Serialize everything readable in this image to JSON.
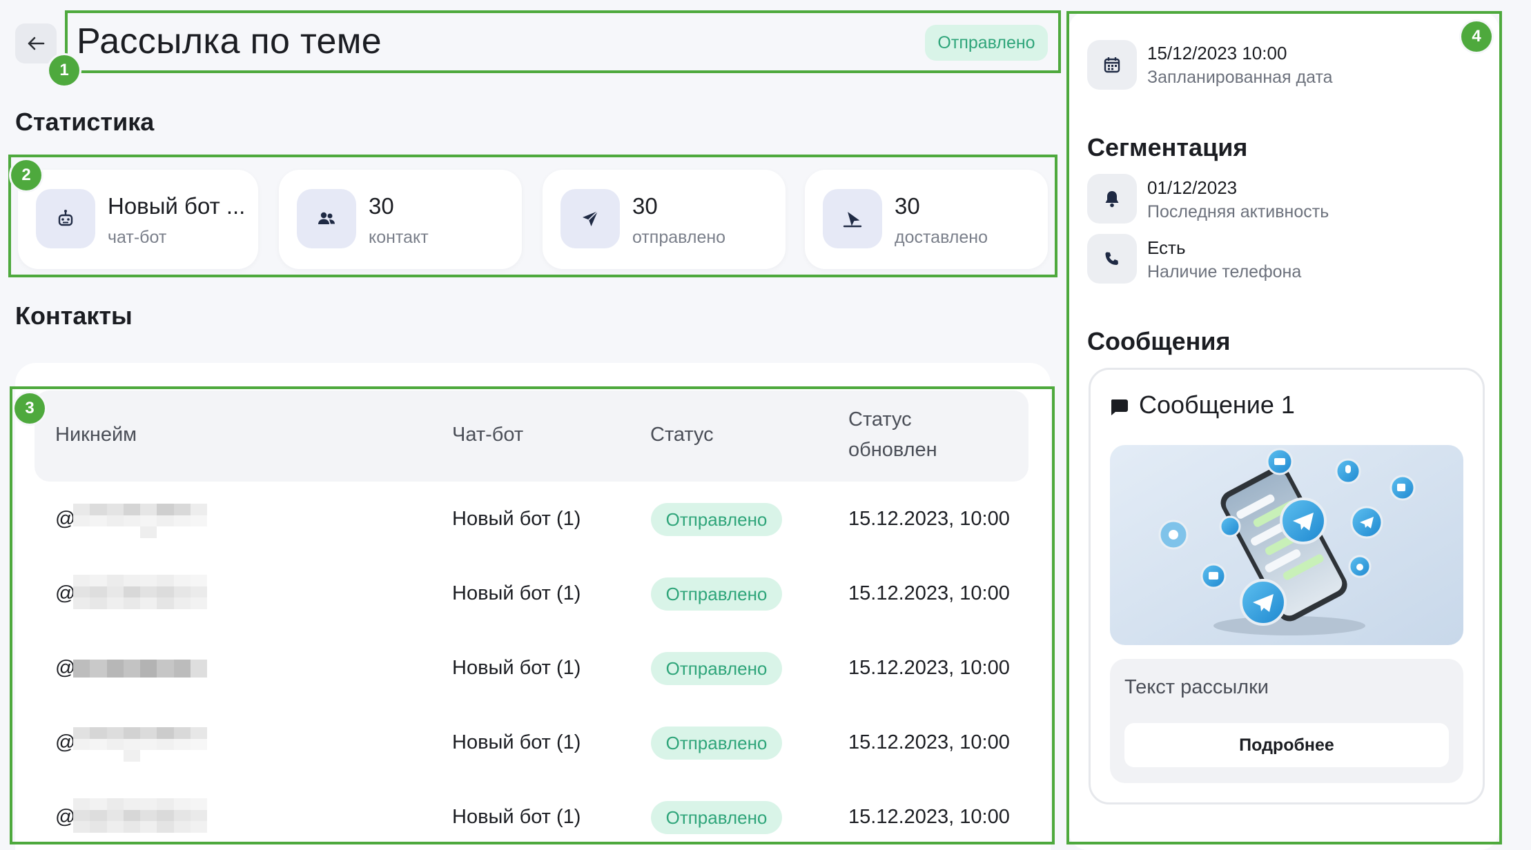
{
  "header": {
    "title": "Рассылка по теме",
    "status": "Отправлено"
  },
  "sections": {
    "stats": "Статистика",
    "contacts": "Контакты",
    "segmentation": "Сегментация",
    "messages": "Сообщения"
  },
  "stats": [
    {
      "value": "Новый бот ...",
      "label": "чат-бот",
      "icon": "bot-icon"
    },
    {
      "value": "30",
      "label": "контакт",
      "icon": "users-icon"
    },
    {
      "value": "30",
      "label": "отправлено",
      "icon": "send-icon"
    },
    {
      "value": "30",
      "label": "доставлено",
      "icon": "delivered-icon"
    }
  ],
  "table": {
    "columns": [
      "Никнейм",
      "Чат-бот",
      "Статус",
      "Статус\nобновлен"
    ],
    "rows": [
      {
        "nickname": "@",
        "bot": "Новый бот (1)",
        "status": "Отправлено",
        "updated": "15.12.2023, 10:00"
      },
      {
        "nickname": "@",
        "bot": "Новый бот (1)",
        "status": "Отправлено",
        "updated": "15.12.2023, 10:00"
      },
      {
        "nickname": "@",
        "bot": "Новый бот (1)",
        "status": "Отправлено",
        "updated": "15.12.2023, 10:00"
      },
      {
        "nickname": "@",
        "bot": "Новый бот (1)",
        "status": "Отправлено",
        "updated": "15.12.2023, 10:00"
      },
      {
        "nickname": "@",
        "bot": "Новый бот (1)",
        "status": "Отправлено",
        "updated": "15.12.2023, 10:00"
      }
    ]
  },
  "schedule": {
    "value": "15/12/2023 10:00",
    "label": "Запланированная дата",
    "icon": "calendar-icon"
  },
  "segments": [
    {
      "value": "01/12/2023",
      "label": "Последняя активность",
      "icon": "bell-icon"
    },
    {
      "value": "Есть",
      "label": "Наличие телефона",
      "icon": "phone-icon"
    }
  ],
  "message": {
    "title": "Сообщение 1",
    "text": "Текст рассылки",
    "more_button": "Подробнее",
    "icon": "chat-bubble-icon"
  },
  "annotations": [
    "1",
    "2",
    "3",
    "4"
  ],
  "colors": {
    "accent_green": "#4ea93d",
    "status_bg": "#d9f4e8",
    "status_text": "#2fa57a",
    "icon_bg": "#e6e9f6",
    "telegram_blue": "#2aa3e0"
  }
}
